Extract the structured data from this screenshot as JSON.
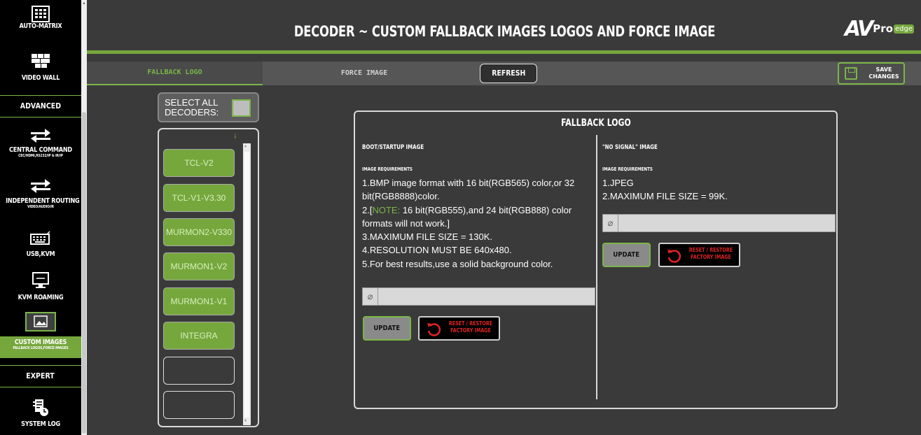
{
  "sidebar": {
    "items": [
      {
        "label": "AUTO-MATRIX",
        "sub": "",
        "icon": "grid-matrix-icon"
      },
      {
        "label": "VIDEO WALL",
        "sub": "",
        "icon": "video-wall-icon"
      },
      {
        "label": "CENTRAL COMMAND",
        "sub": "CEC/HDMI,RS232/IP & IR/IP",
        "icon": "double-arrow-icon"
      },
      {
        "label": "INDEPENDENT ROUTING",
        "sub": "VIDEO/AUDIO/IR",
        "icon": "double-arrow-icon"
      },
      {
        "label": "USB,KVM",
        "sub": "",
        "icon": "keyboard-icon"
      },
      {
        "label": "KVM ROAMING",
        "sub": "",
        "icon": "monitor-icon"
      },
      {
        "label": "CUSTOM IMAGES",
        "sub": "FALLBACK LOGOS,FORCE IMAGES",
        "icon": "image-icon"
      },
      {
        "label": "SYSTEM LOG",
        "sub": "",
        "icon": "log-clock-icon"
      }
    ],
    "sections": {
      "advanced": "ADVANCED",
      "expert": "EXPERT"
    }
  },
  "header": {
    "title": "DECODER ~ CUSTOM FALLBACK IMAGES LOGOS AND FORCE IMAGE",
    "brand": {
      "av": "AV",
      "pro": "Pro",
      "edge": "edge"
    }
  },
  "tabs": {
    "fallback": "FALLBACK LOGO",
    "force": "FORCE IMAGE"
  },
  "toolbar": {
    "refresh": "REFRESH",
    "save_line1": "SAVE",
    "save_line2": "CHANGES"
  },
  "decoders": {
    "select_all_label": "SELECT ALL DECODERS:",
    "items": [
      "TCL-V2",
      "TCL-V1-V3.30",
      "MURMON2-V330",
      "MURMON1-V2",
      "MURMON1-V1",
      "INTEGRA"
    ]
  },
  "panel": {
    "title": "FALLBACK LOGO",
    "boot": {
      "heading": "BOOT/STARTUP IMAGE",
      "req_heading": "IMAGE REQUIREMENTS",
      "line1a": "1.BMP image format with 16 bit(RGB565) color,or 32",
      "line1b": "bit(RGB8888)color.",
      "line2_prefix": "2.[",
      "line2_note": "NOTE:",
      "line2_rest": " 16 bit(RGB555),and 24 bit(RGB888) color",
      "line2b": "formats will not work.]",
      "line3": "3.MAXIMUM FILE SIZE = 130K.",
      "line4": "4.RESOLUTION MUST BE 640x480.",
      "line5": "5.For best results,use a solid background color."
    },
    "nosignal": {
      "heading": "\"NO SIGNAL\" IMAGE",
      "req_heading": "IMAGE REQUIREMENTS",
      "line1": "1.JPEG",
      "line2": "2.MAXIMUM FILE SIZE = 99K."
    },
    "update_label": "UPDATE",
    "reset_line1": "RESET / RESTORE",
    "reset_line2": "FACTORY IMAGE"
  },
  "colors": {
    "accent": "#7ab648",
    "active": "#76a73d",
    "reset_red": "#e12323"
  }
}
